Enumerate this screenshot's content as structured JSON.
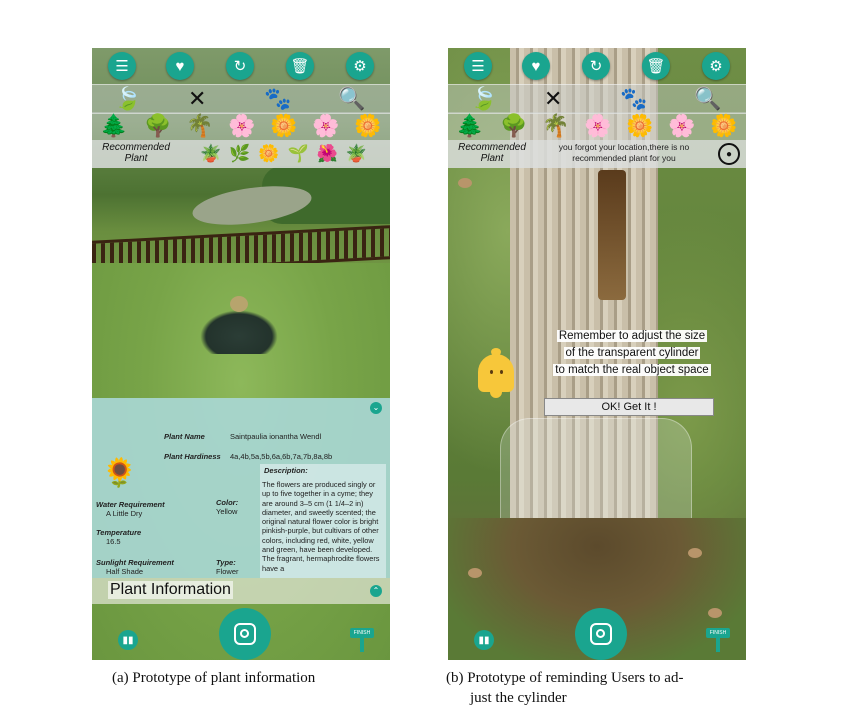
{
  "panel_a": {
    "recommended_label_1": "Recommended",
    "recommended_label_2": "Plant",
    "info": {
      "plant_name_label": "Plant Name",
      "plant_name": "Saintpaulia ionantha Wendl",
      "hardiness_label": "Plant Hardiness",
      "hardiness": "4a,4b,5a,5b,6a,6b,7a,7b,8a,8b",
      "description_label": "Description:",
      "description": "The flowers are produced singly or up to five together in a cyme; they are around 3–5 cm (1 1/4–2 in) diameter, and sweetly scented; the original natural flower color is bright pinkish-purple, but cultivars of other colors, including red, white, yellow and green, have been developed. The fragrant, hermaphrodite flowers have a",
      "water_label": "Water Requirement",
      "water": "A Little Dry",
      "color_label": "Color:",
      "color": "Yellow",
      "temperature_label": "Temperature",
      "temperature": "16.5",
      "sunlight_label": "Sunlight Requirement",
      "sunlight": "Half Shade",
      "type_label": "Type:",
      "type": "Flower"
    },
    "info_bar_title": "Plant Information",
    "finish_label": "FINISH"
  },
  "panel_b": {
    "recommended_label_1": "Recommended",
    "recommended_label_2": "Plant",
    "recommend_message_1": "you forgot your location,there is no",
    "recommend_message_2": "recommended plant for you",
    "remind_line_1": "Remember to adjust the size",
    "remind_line_2": "of the transparent cylinder",
    "remind_line_3": "to match the real object space",
    "ok_button": "OK!   Get It !",
    "finish_label": "FINISH"
  },
  "icons": {
    "top": [
      "list-icon",
      "heart-icon",
      "refresh-icon",
      "trash-icon",
      "settings-icon"
    ],
    "categories": [
      "leaf-icon",
      "windmill-icon",
      "paw-icon",
      "search-icon"
    ],
    "flowers": [
      "conifer-icon",
      "tree-icon",
      "palm-icon",
      "pink-flower-icon",
      "orange-flower-icon",
      "blue-flower-icon",
      "white-flower-icon"
    ]
  },
  "colors": {
    "accent": "#1aa58f",
    "info_panel": "#a8d6d2",
    "bell": "#f7c73a"
  },
  "captions": {
    "a": "(a) Prototype of plant information",
    "b_line1": "(b) Prototype of reminding Users to ad-",
    "b_line2": "just the cylinder"
  }
}
